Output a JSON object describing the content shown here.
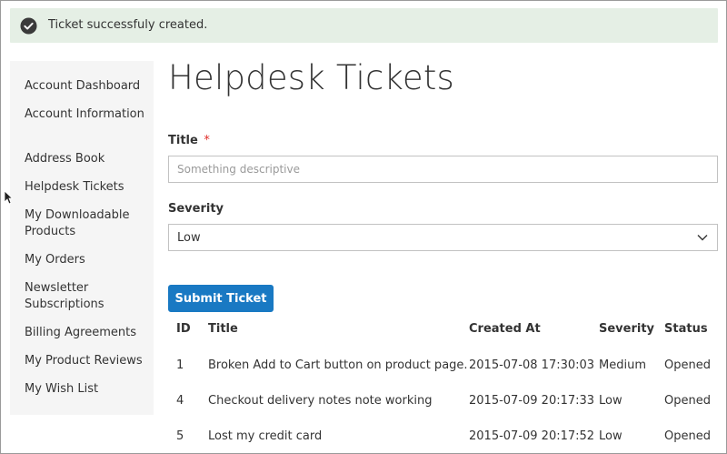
{
  "notice": {
    "icon": "check-circle-icon",
    "text": "Ticket successfuly created."
  },
  "sidebar": {
    "items": [
      {
        "label": "Account Dashboard"
      },
      {
        "label": "Account Information"
      },
      {
        "label": "Address Book"
      },
      {
        "label": "Helpdesk Tickets"
      },
      {
        "label": "My Downloadable Products"
      },
      {
        "label": "My Orders"
      },
      {
        "label": "Newsletter Subscriptions"
      },
      {
        "label": "Billing Agreements"
      },
      {
        "label": "My Product Reviews"
      },
      {
        "label": "My Wish List"
      }
    ]
  },
  "main": {
    "page_title": "Helpdesk Tickets",
    "form": {
      "title_label": "Title",
      "required_mark": "*",
      "title_value": "",
      "title_placeholder": "Something descriptive",
      "severity_label": "Severity",
      "severity_value": "Low",
      "submit_label": "Submit Ticket"
    },
    "table": {
      "headers": {
        "id": "ID",
        "title": "Title",
        "created_at": "Created At",
        "severity": "Severity",
        "status": "Status"
      },
      "rows": [
        {
          "id": "1",
          "title": "Broken Add to Cart button on product page.",
          "created_at": "2015-07-08 17:30:03",
          "severity": "Medium",
          "status": "Opened"
        },
        {
          "id": "4",
          "title": "Checkout delivery notes note working",
          "created_at": "2015-07-09 20:17:33",
          "severity": "Low",
          "status": "Opened"
        },
        {
          "id": "5",
          "title": "Lost my credit card",
          "created_at": "2015-07-09 20:17:52",
          "severity": "Low",
          "status": "Opened"
        }
      ]
    }
  },
  "colors": {
    "notice_bg": "#e5efe5",
    "sidebar_bg": "#f5f5f5",
    "primary_button": "#1979c3",
    "required": "#e02b27"
  }
}
